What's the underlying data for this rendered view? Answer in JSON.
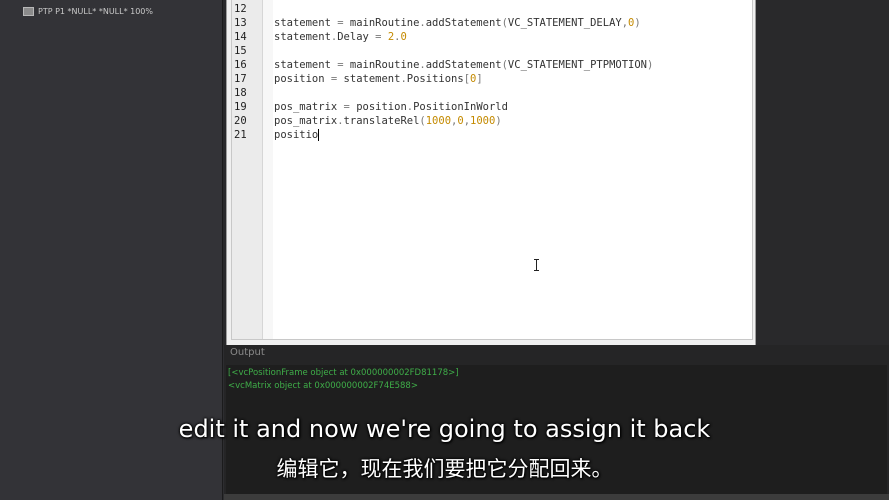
{
  "tree": {
    "items": [
      {
        "label": "PTP P1 *NULL* *NULL* 100%"
      }
    ]
  },
  "editor": {
    "lines": [
      {
        "num": "12",
        "code": ""
      },
      {
        "num": "13",
        "code": "statement = mainRoutine.addStatement(VC_STATEMENT_DELAY,0)"
      },
      {
        "num": "14",
        "code": "statement.Delay = 2.0"
      },
      {
        "num": "15",
        "code": ""
      },
      {
        "num": "16",
        "code": "statement = mainRoutine.addStatement(VC_STATEMENT_PTPMOTION)"
      },
      {
        "num": "17",
        "code": "position = statement.Positions[0]"
      },
      {
        "num": "18",
        "code": ""
      },
      {
        "num": "19",
        "code": "pos_matrix = position.PositionInWorld"
      },
      {
        "num": "20",
        "code": "pos_matrix.translateRel(1000,0,1000)"
      },
      {
        "num": "21",
        "code": "positio"
      }
    ]
  },
  "output": {
    "title": "Output",
    "lines": [
      "[<vcPositionFrame object at 0x000000002FD81178>]",
      "<vcMatrix object at 0x000000002F74E588>"
    ]
  },
  "subtitles": {
    "english": "edit it and now we're going to assign it back",
    "chinese": "编辑它，现在我们要把它分配回来。"
  },
  "colors": {
    "number": "#c48a00",
    "output_text": "#3fae49"
  }
}
